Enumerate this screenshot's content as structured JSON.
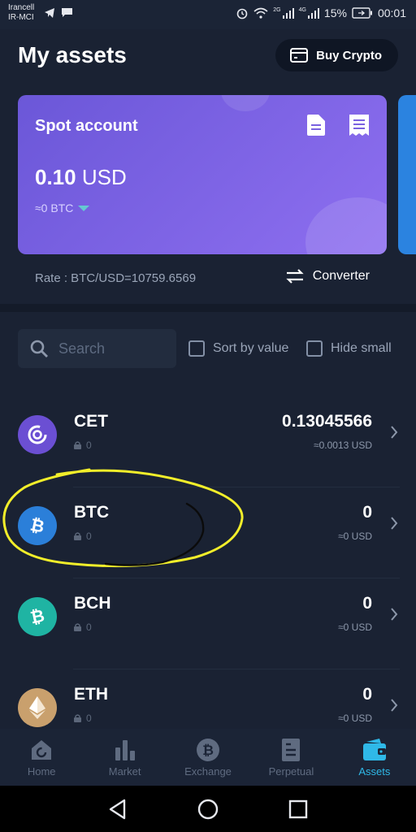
{
  "status_bar": {
    "carrier_1": "Irancell",
    "carrier_2": "IR-MCI",
    "network_1": "2G",
    "network_2": "4G",
    "battery": "15%",
    "time": "00:01"
  },
  "header": {
    "title": "My assets",
    "buy_button_label": "Buy Crypto"
  },
  "account_card": {
    "title": "Spot account",
    "amount": "0.10",
    "currency": "USD",
    "btc_equivalent": "≈0  BTC",
    "rate": "Rate :  BTC/USD=10759.6569",
    "converter_label": "Converter"
  },
  "filters": {
    "search_placeholder": "Search",
    "sort_by_value_label": "Sort by value",
    "hide_small_label": "Hide small"
  },
  "assets": [
    {
      "symbol": "CET",
      "locked": "0",
      "amount": "0.13045566",
      "usd": "≈0.0013 USD",
      "color": "#6b4fd3"
    },
    {
      "symbol": "BTC",
      "locked": "0",
      "amount": "0",
      "usd": "≈0 USD",
      "color": "#2b7fd9"
    },
    {
      "symbol": "BCH",
      "locked": "0",
      "amount": "0",
      "usd": "≈0 USD",
      "color": "#1fb4a3"
    },
    {
      "symbol": "ETH",
      "locked": "0",
      "amount": "0",
      "usd": "≈0 USD",
      "color": "#c9a06d"
    }
  ],
  "bottom_nav": {
    "items": [
      {
        "label": "Home",
        "icon": "home-icon"
      },
      {
        "label": "Market",
        "icon": "market-bars-icon"
      },
      {
        "label": "Exchange",
        "icon": "exchange-bitcoin-icon"
      },
      {
        "label": "Perpetual",
        "icon": "perpetual-doc-icon"
      },
      {
        "label": "Assets",
        "icon": "wallet-icon"
      }
    ],
    "active": "Assets"
  },
  "colors": {
    "background": "#1a2233",
    "card_gradient_start": "#6b57d8",
    "card_gradient_end": "#8e6ff0",
    "accent": "#2fb9e8",
    "annotation_yellow": "#f2ee2a"
  }
}
